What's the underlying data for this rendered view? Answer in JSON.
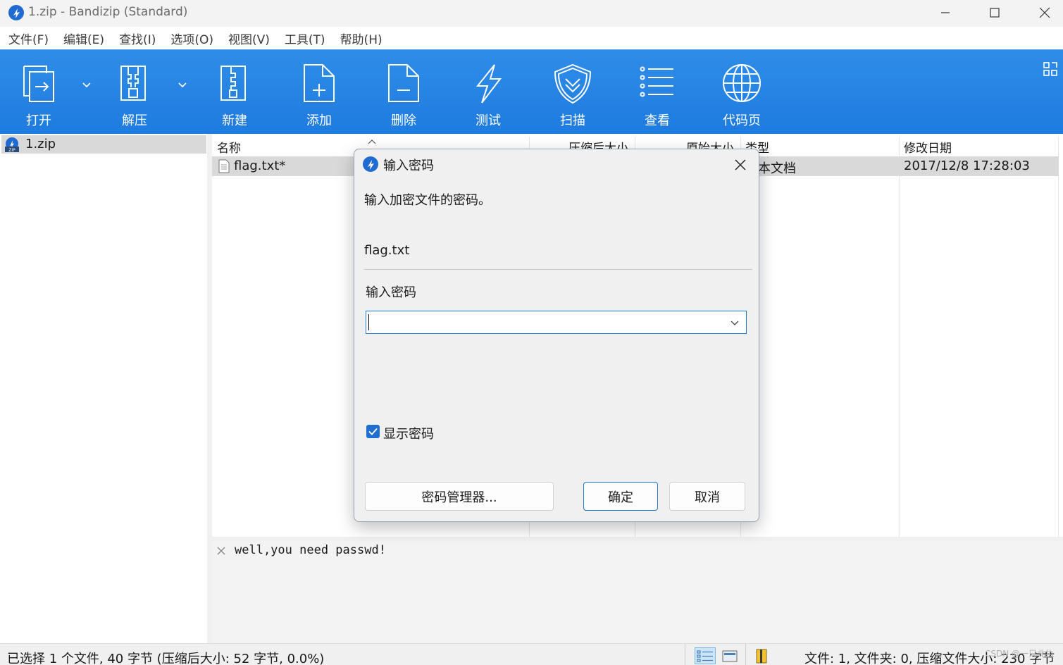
{
  "window": {
    "title": "1.zip - Bandizip (Standard)"
  },
  "menu": [
    "文件(F)",
    "编辑(E)",
    "查找(I)",
    "选项(O)",
    "视图(V)",
    "工具(T)",
    "帮助(H)"
  ],
  "toolbar": {
    "buttons": [
      {
        "label": "打开",
        "icon": "open-icon"
      },
      {
        "label": "解压",
        "icon": "extract-icon"
      },
      {
        "label": "新建",
        "icon": "new-archive-icon"
      },
      {
        "label": "添加",
        "icon": "add-file-icon"
      },
      {
        "label": "删除",
        "icon": "delete-file-icon"
      },
      {
        "label": "测试",
        "icon": "lightning-icon"
      },
      {
        "label": "扫描",
        "icon": "shield-icon"
      },
      {
        "label": "查看",
        "icon": "list-icon"
      },
      {
        "label": "代码页",
        "icon": "globe-icon"
      }
    ]
  },
  "tree": {
    "item": "1.zip"
  },
  "filelist": {
    "columns": [
      "名称",
      "压缩后大小",
      "原始大小",
      "类型",
      "修改日期"
    ],
    "rows": [
      {
        "name": "flag.txt*",
        "type": "文本文档",
        "modified": "2017/12/8 17:28:03"
      }
    ]
  },
  "comment": {
    "text": "well,you need passwd!"
  },
  "status": {
    "left": "已选择 1 个文件, 40 字节 (压缩后大小: 52 字节, 0.0%)",
    "right": "文件: 1, 文件夹: 0, 压缩文件大小: 230 字节",
    "watermark": "CSDN @一只北执"
  },
  "dialog": {
    "title": "输入密码",
    "prompt": "输入加密文件的密码。",
    "filename": "flag.txt",
    "field_label": "输入密码",
    "password_value": "",
    "show_password_label": "显示密码",
    "show_password_checked": true,
    "manager_button": "密码管理器...",
    "ok_button": "确定",
    "cancel_button": "取消"
  },
  "colors": {
    "toolbar_blue": "#1e7be0",
    "accent": "#2077d4",
    "selection_gray": "#d9d9d9"
  }
}
